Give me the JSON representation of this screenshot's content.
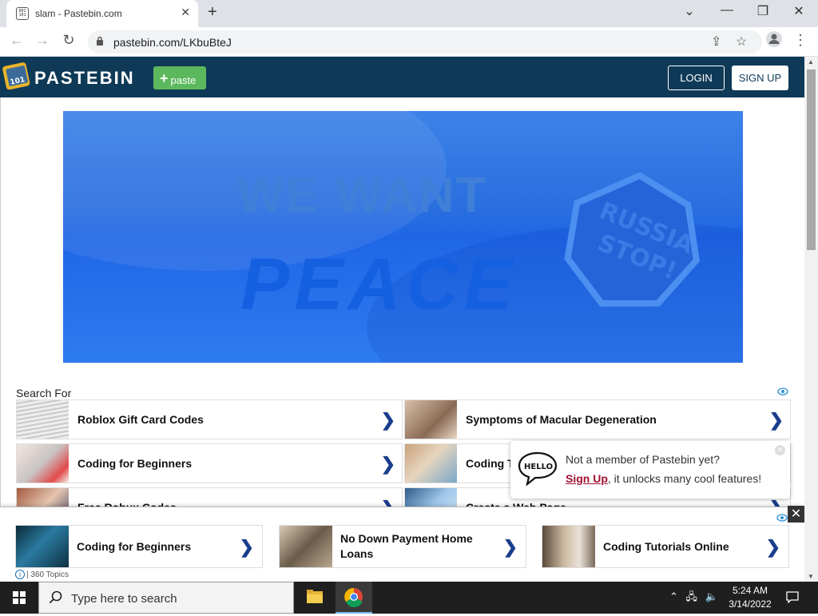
{
  "browser": {
    "tab_title": "slam - Pastebin.com",
    "favicon_text": "001 101",
    "url": "pastebin.com/LKbuBteJ"
  },
  "site": {
    "brand": "PASTEBIN",
    "logo_text": "101",
    "paste_label": "paste",
    "login_label": "LOGIN",
    "signup_label": "SIGN UP"
  },
  "banner": {
    "line1": "WE WANT",
    "line2": "PEACE",
    "sign_line1": "RUSSIA",
    "sign_line2": "STOP!"
  },
  "search": {
    "heading": "Search For",
    "items": [
      {
        "label": "Roblox Gift Card Codes"
      },
      {
        "label": "Symptoms of Macular Degeneration"
      },
      {
        "label": "Coding for Beginners"
      },
      {
        "label": "Coding T"
      },
      {
        "label": "Free Robux Codes"
      },
      {
        "label": "Create a Web Page"
      }
    ]
  },
  "popup": {
    "line1": "Not a member of Pastebin yet?",
    "signup_link": "Sign Up",
    "line2_rest": ", it unlocks many cool features!",
    "hello": "HELLO"
  },
  "bottom_ad": {
    "items": [
      {
        "label": "Coding for Beginners"
      },
      {
        "label": "No Down Payment Home Loans"
      },
      {
        "label": "Coding Tutorials Online"
      }
    ],
    "topics": "| 360 Topics"
  },
  "taskbar": {
    "search_placeholder": "Type here to search",
    "time": "5:24 AM",
    "date": "3/14/2022"
  }
}
